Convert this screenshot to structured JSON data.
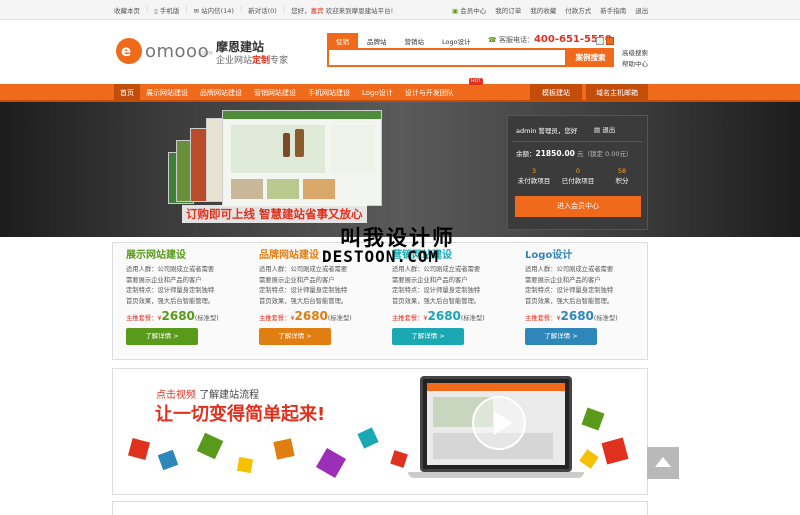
{
  "topbar": {
    "left": [
      "收藏本页",
      "手机版",
      "站内信(14)",
      "新对话(0)",
      "您好，",
      "嘉宾",
      "欢迎来到摩恩建站平台!"
    ],
    "right": [
      "会员中心",
      "我的订单",
      "我的收藏",
      "付款方式",
      "新手指南",
      "退出"
    ]
  },
  "logo": {
    "mark": "e",
    "word": "omooo",
    "domain": ".com"
  },
  "brand": {
    "title": "摩恩建站",
    "sub_pre": "企业网站",
    "sub_hl": "定制",
    "sub_post": "专家"
  },
  "search": {
    "tabs": [
      "促销",
      "品牌站",
      "营销站",
      "Logo设计"
    ],
    "hotline_label": "客服电话：",
    "hotline": "400-651-5550",
    "button": "案例搜索",
    "links": [
      "高级搜索",
      "帮助中心"
    ]
  },
  "nav": {
    "items": [
      "首页",
      "展示网站建设",
      "品牌网站建设",
      "营销网站建设",
      "手机网站建设",
      "Logo设计",
      "设计与开发团队"
    ],
    "hot": "HOT",
    "right": [
      "模板建站",
      "域名主机邮箱"
    ]
  },
  "banner": {
    "slogan": "订购即可上线 智慧建站省事又放心"
  },
  "member": {
    "hello": "admin 管理员，您好",
    "exit": "退出",
    "balance_label": "余额：",
    "balance": "21850.00",
    "balance_note": "元（锁定 0.00元）",
    "stats": [
      {
        "n": "3",
        "label": "未付款项目"
      },
      {
        "n": "0",
        "label": "已付款项目"
      },
      {
        "n": "58",
        "label": "积分"
      }
    ],
    "cta": "进入会员中心"
  },
  "products": [
    {
      "title": "展示网站建设",
      "color": "#5a9a1a",
      "desc1": "适用人群：公司刚成立或者需要",
      "desc2": "需要展示企业和产品的客户",
      "desc3": "定制特点：设计师量身定制独特",
      "desc4": "首页效果，强大后台智能管理。",
      "price_label": "主推套餐：¥",
      "price": "2680",
      "price_note": "(标准型)",
      "btn": "了解详情 >"
    },
    {
      "title": "品牌网站建设",
      "color": "#e07e12",
      "desc1": "适用人群：公司刚成立或者需要",
      "desc2": "需要展示企业和产品的客户",
      "desc3": "定制特点：设计师量身定制独特",
      "desc4": "首页效果，强大后台智能管理。",
      "price_label": "主推套餐：¥",
      "price": "2680",
      "price_note": "(标准型)",
      "btn": "了解详情 >"
    },
    {
      "title": "营销网站建设",
      "color": "#1aa9b3",
      "desc1": "适用人群：公司刚成立或者需要",
      "desc2": "需要展示企业和产品的客户",
      "desc3": "定制特点：设计师量身定制独特",
      "desc4": "首页效果，强大后台智能管理。",
      "price_label": "主推套餐：¥",
      "price": "2680",
      "price_note": "(标准型)",
      "btn": "了解详情 >"
    },
    {
      "title": "Logo设计",
      "color": "#2f86b8",
      "desc1": "适用人群：公司刚成立或者需要",
      "desc2": "需要展示企业和产品的客户",
      "desc3": "定制特点：设计师量身定制独特",
      "desc4": "首页效果，强大后台智能管理。",
      "price_label": "主推套餐：¥",
      "price": "2680",
      "price_note": "(标准型)",
      "btn": "了解详情 >"
    }
  ],
  "video": {
    "link": "点击视频",
    "link2": "了解建站流程",
    "slogan": "让一切变得简单起来!"
  },
  "watermark": {
    "line1": "叫我设计师",
    "line2": "DESTOON.COM"
  }
}
